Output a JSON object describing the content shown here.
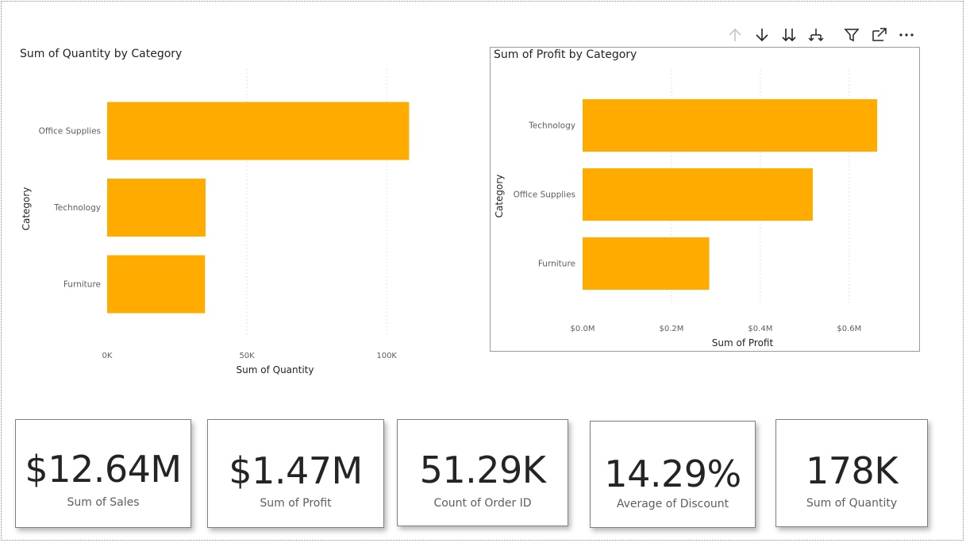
{
  "colors": {
    "bar": "#FFAB00",
    "grid": "#d9d9d9",
    "axis_text": "#605e5c"
  },
  "toolbar": {
    "icons": [
      "arrow-up-icon",
      "arrow-down-icon",
      "double-arrow-down-icon",
      "expand-hierarchy-icon",
      "filter-icon",
      "focus-mode-icon",
      "more-options-icon"
    ]
  },
  "chart_data": [
    {
      "type": "bar",
      "orientation": "horizontal",
      "title": "Sum of Quantity by Category",
      "xlabel": "Sum of Quantity",
      "ylabel": "Category",
      "categories": [
        "Office Supplies",
        "Technology",
        "Furniture"
      ],
      "values": [
        108000,
        35200,
        35000
      ],
      "xlim": [
        0,
        115000
      ],
      "xticks": [
        0,
        50000,
        100000
      ],
      "xtick_labels": [
        "0K",
        "50K",
        "100K"
      ],
      "grid": true
    },
    {
      "type": "bar",
      "orientation": "horizontal",
      "title": "Sum of Profit by Category",
      "xlabel": "Sum of Profit",
      "ylabel": "Category",
      "categories": [
        "Technology",
        "Office Supplies",
        "Furniture"
      ],
      "values": [
        663000,
        518000,
        285000
      ],
      "xlim": [
        0,
        720000
      ],
      "xticks": [
        0,
        200000,
        400000,
        600000
      ],
      "xtick_labels": [
        "$0.0M",
        "$0.2M",
        "$0.4M",
        "$0.6M"
      ],
      "grid": true
    }
  ],
  "cards": [
    {
      "value": "$12.64M",
      "label": "Sum of Sales"
    },
    {
      "value": "$1.47M",
      "label": "Sum of Profit"
    },
    {
      "value": "51.29K",
      "label": "Count of Order ID"
    },
    {
      "value": "14.29%",
      "label": "Average of Discount"
    },
    {
      "value": "178K",
      "label": "Sum of Quantity"
    }
  ]
}
